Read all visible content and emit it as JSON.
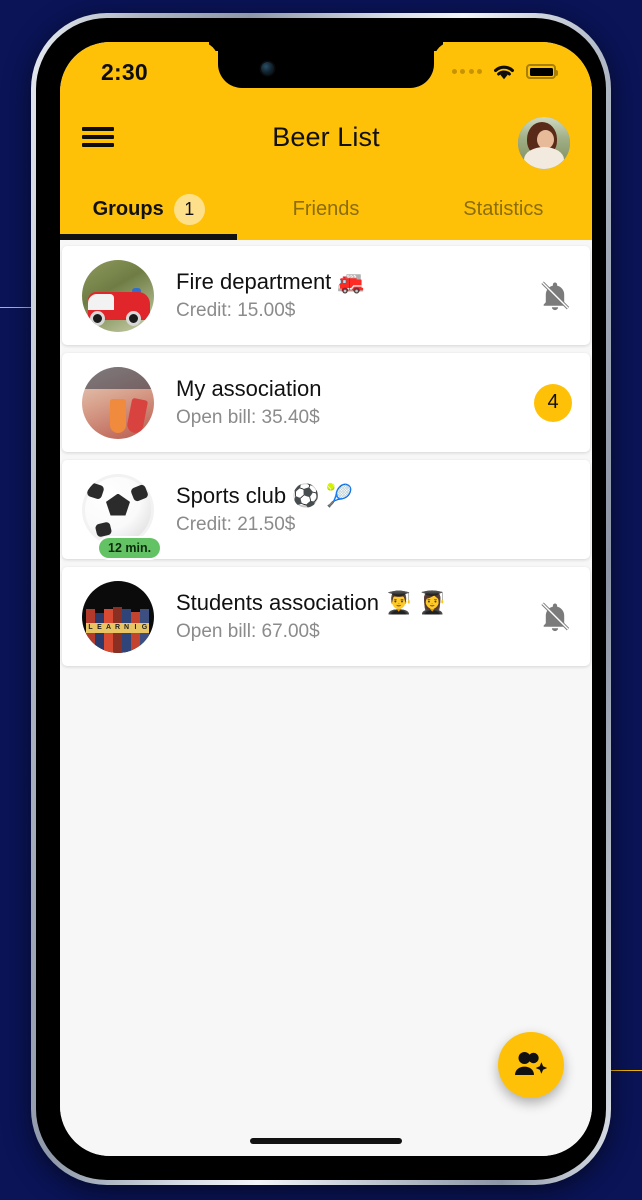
{
  "background_color": "#0a1457",
  "accent_color": "#ffc107",
  "status_bar": {
    "time": "2:30",
    "signal_icon": "cellular-dots-icon",
    "wifi_icon": "wifi-icon",
    "battery_icon": "battery-full-icon"
  },
  "app_bar": {
    "menu_icon": "hamburger-menu-icon",
    "title": "Beer List",
    "avatar_icon": "user-avatar-photo"
  },
  "tabs": [
    {
      "label": "Groups",
      "badge": "1",
      "active": true
    },
    {
      "label": "Friends",
      "badge": "",
      "active": false
    },
    {
      "label": "Statistics",
      "badge": "",
      "active": false
    }
  ],
  "groups": [
    {
      "title": "Fire department 🚒",
      "subtitle": "Credit: 15.00$",
      "avatar": "fire-truck-photo",
      "trailing_type": "bell-muted",
      "trailing_value": "",
      "time_badge": ""
    },
    {
      "title": "My association",
      "subtitle": "Open bill: 35.40$",
      "avatar": "cocktail-drinks-photo",
      "trailing_type": "count-badge",
      "trailing_value": "4",
      "time_badge": ""
    },
    {
      "title": "Sports club ⚽ 🎾",
      "subtitle": "Credit: 21.50$",
      "avatar": "soccer-ball-photo",
      "trailing_type": "none",
      "trailing_value": "",
      "time_badge": "12 min."
    },
    {
      "title": "Students association 👨‍🎓 👩‍🎓",
      "subtitle": "Open bill: 67.00$",
      "avatar": "books-shelf-photo",
      "trailing_type": "bell-muted",
      "trailing_value": "",
      "time_badge": ""
    }
  ],
  "fab": {
    "icon": "add-group-member-icon",
    "color": "#ffc107"
  },
  "home_indicator": "home-indicator-bar"
}
